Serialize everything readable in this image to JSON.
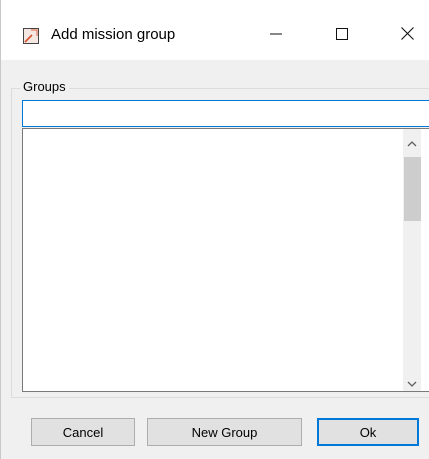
{
  "window": {
    "title": "Add mission group",
    "icon": "mission-app-icon",
    "controls": [
      "minimize-icon",
      "maximize-icon",
      "close-icon"
    ]
  },
  "groups": {
    "label": "Groups",
    "input_value": "",
    "items": []
  },
  "buttons": {
    "cancel": "Cancel",
    "new_group": "New Group",
    "ok": "Ok"
  },
  "colors": {
    "focus_accent": "#0078d7",
    "window_bg": "#f0f0f0"
  }
}
